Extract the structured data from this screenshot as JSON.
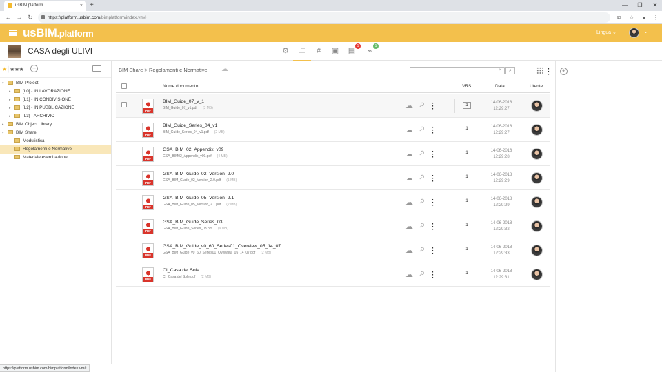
{
  "browser": {
    "tab_title": "usBIM.platform",
    "tab_close": "×",
    "new_tab": "+",
    "url_host": "https://platform.usbim.com",
    "url_path": "/bimplatform/index.vm#",
    "status_url": "https://platform.usbim.com/bimplatform/index.vm#"
  },
  "app": {
    "logo_prefix": "us",
    "logo_bim": "BIM",
    "logo_suffix": ".platform",
    "language_label": "Lingua",
    "brand_color": "#f3c04c"
  },
  "project": {
    "title": "CASA degli ULIVI",
    "tools": [
      {
        "icon": "gear-icon",
        "glyph": "⚙"
      },
      {
        "icon": "folder-icon",
        "glyph": "▭",
        "active": true
      },
      {
        "icon": "hashtag-icon",
        "glyph": "#"
      },
      {
        "icon": "briefcase-icon",
        "glyph": "▣"
      },
      {
        "icon": "clipboard-icon",
        "glyph": "▤"
      },
      {
        "icon": "activity-icon",
        "glyph": "⌁"
      }
    ],
    "badge_red": "1",
    "badge_green": "1"
  },
  "tree": {
    "stars": "★★★★",
    "plus": "+",
    "nodes": [
      {
        "label": "BIM Project",
        "level": 0,
        "toggle": "▾"
      },
      {
        "label": "[L0] - IN LAVORAZIONE",
        "level": 1,
        "toggle": "▸"
      },
      {
        "label": "[L1] - IN CONDIVISIONE",
        "level": 1,
        "toggle": "▸"
      },
      {
        "label": "[L2] - IN PUBBLICAZIONE",
        "level": 1,
        "toggle": "▸"
      },
      {
        "label": "[L3] - ARCHIVIO",
        "level": 1,
        "toggle": "▸"
      },
      {
        "label": "BIM Object Library",
        "level": 0,
        "toggle": "▸"
      },
      {
        "label": "BIM Share",
        "level": 0,
        "toggle": "▾"
      },
      {
        "label": "Modulistica",
        "level": 1,
        "toggle": ""
      },
      {
        "label": "Regolamenti e Normative",
        "level": 1,
        "toggle": "",
        "selected": true
      },
      {
        "label": "Materiale esercitazione",
        "level": 1,
        "toggle": ""
      }
    ]
  },
  "main": {
    "breadcrumb": "BIM Share > Regolamenti e Normative",
    "search_placeholder": "",
    "search_clear": "×",
    "columns": {
      "name": "Nome documento",
      "vrs": "VRS",
      "date": "Data",
      "user": "Utente"
    },
    "files": [
      {
        "name": "BIM_Guide_07_v_1",
        "file": "BIM_Guide_07_v1.pdf",
        "size": "(3 MB)",
        "vrs": "1",
        "date": "14-06-2018",
        "time": "12:29:27"
      },
      {
        "name": "BIM_Guide_Series_04_v1",
        "file": "BIM_Guide_Series_04_v1.pdf",
        "size": "(2 MB)",
        "vrs": "1",
        "date": "14-06-2018",
        "time": "12:29:27"
      },
      {
        "name": "GSA_BIM_02_Appendix_v09",
        "file": "GSA_BIM02_Appendix_v09.pdf",
        "size": "(4 MB)",
        "vrs": "1",
        "date": "14-06-2018",
        "time": "12:29:28"
      },
      {
        "name": "GSA_BIM_Guide_02_Version_2.0",
        "file": "GSA_BIM_Guide_02_Version_2.0.pdf",
        "size": "(1 MB)",
        "vrs": "1",
        "date": "14-06-2018",
        "time": "12:29:29"
      },
      {
        "name": "GSA_BIM_Guide_05_Version_2.1",
        "file": "GSA_BIM_Guide_05_Version_2.1.pdf",
        "size": "(2 MB)",
        "vrs": "1",
        "date": "14-06-2018",
        "time": "12:29:29"
      },
      {
        "name": "GSA_BIM_Guide_Series_03",
        "file": "GSA_BIM_Guide_Series_03.pdf",
        "size": "(9 MB)",
        "vrs": "1",
        "date": "14-06-2018",
        "time": "12:29:32"
      },
      {
        "name": "GSA_BIM_Guide_v0_60_Series01_Overview_05_14_07",
        "file": "GSA_BIM_Guide_v0_60_Series01_Overview_05_14_07.pdf",
        "size": "(2 MB)",
        "vrs": "1",
        "date": "14-06-2018",
        "time": "12:29:33"
      },
      {
        "name": "CI_Casa del Sole",
        "file": "CI_Casa del Sole.pdf",
        "size": "(2 MB)",
        "vrs": "1",
        "date": "14-06-2018",
        "time": "12:29:31"
      }
    ]
  }
}
